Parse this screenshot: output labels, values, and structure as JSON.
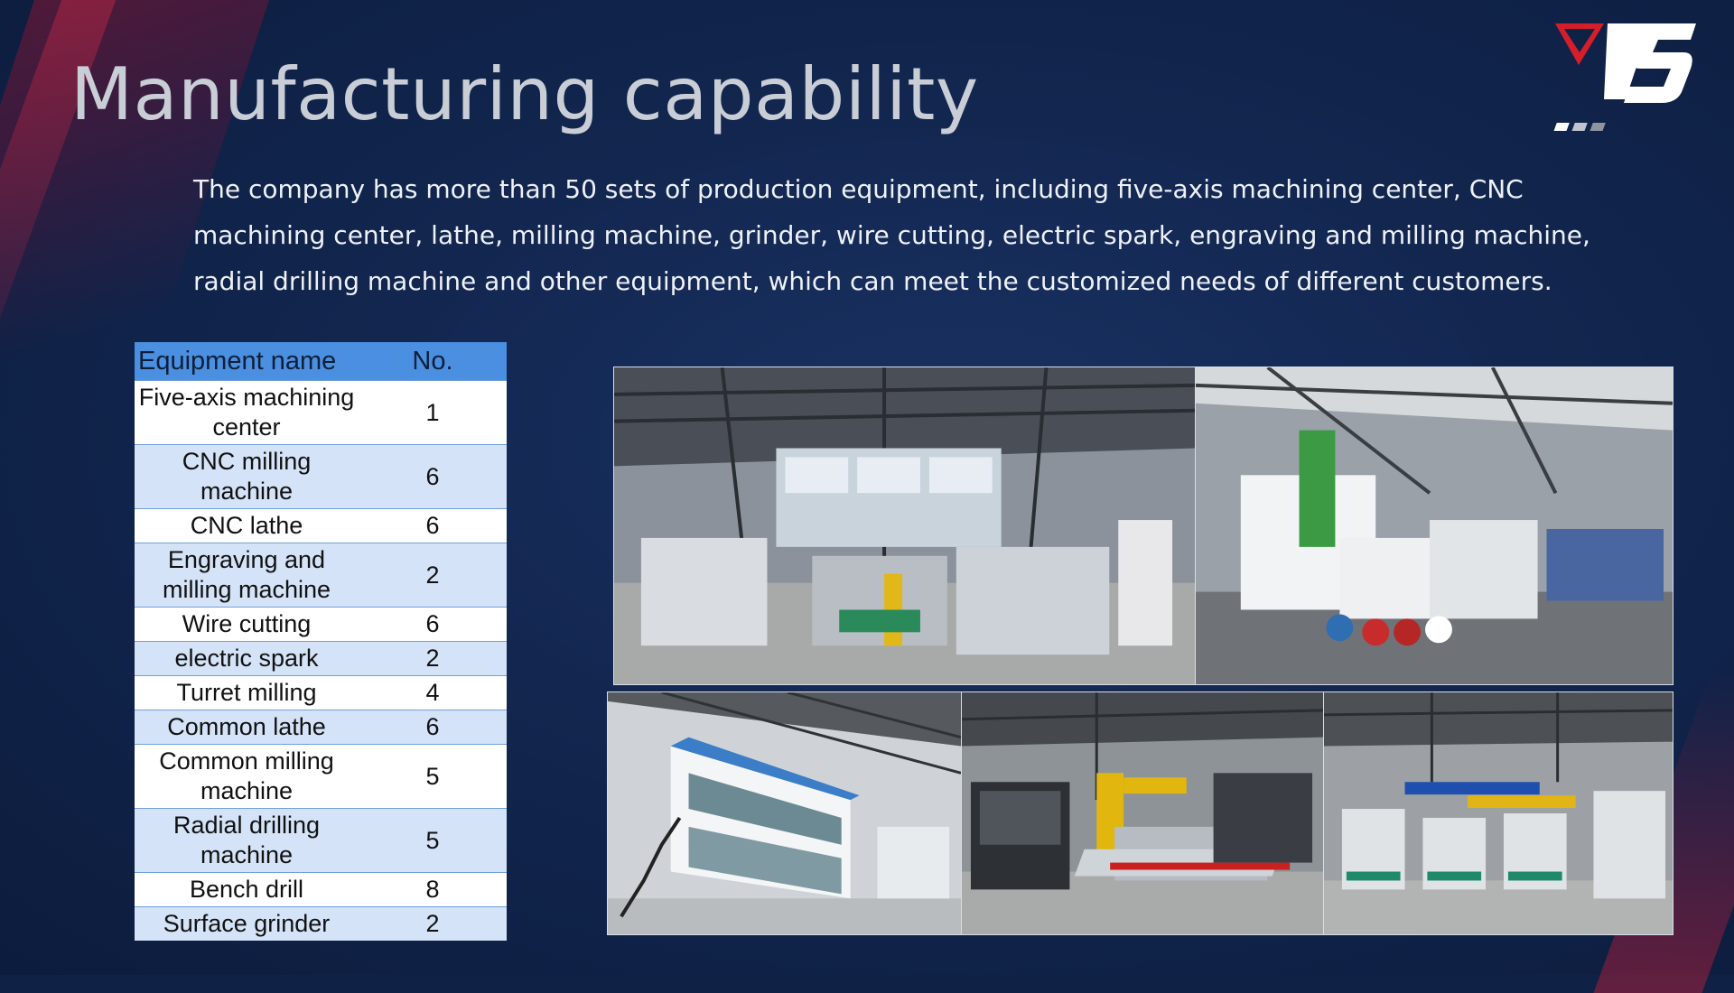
{
  "slide": {
    "title": "Manufacturing capability",
    "intro": "The company has more than 50 sets of production equipment, including five-axis machining center, CNC machining center, lathe, milling machine, grinder, wire cutting, electric spark, engraving and milling machine, radial drilling machine and other equipment, which can meet the customized needs of different customers."
  },
  "table": {
    "headers": [
      "Equipment name",
      "No."
    ],
    "rows": [
      {
        "name": "Five-axis machining center",
        "no": "1"
      },
      {
        "name": "CNC milling machine",
        "no": "6"
      },
      {
        "name": "CNC lathe",
        "no": "6"
      },
      {
        "name": "Engraving and milling machine",
        "no": "2"
      },
      {
        "name": "Wire cutting",
        "no": "6"
      },
      {
        "name": "electric spark",
        "no": "2"
      },
      {
        "name": "Turret milling",
        "no": "4"
      },
      {
        "name": "Common lathe",
        "no": "6"
      },
      {
        "name": "Common milling machine",
        "no": "5"
      },
      {
        "name": "Radial drilling machine",
        "no": "5"
      },
      {
        "name": "Bench drill",
        "no": "8"
      },
      {
        "name": "Surface grinder",
        "no": "2"
      }
    ]
  },
  "photos": [
    {
      "icon": "factory-floor-photo"
    },
    {
      "icon": "machining-center-photo"
    },
    {
      "icon": "office-building-photo"
    },
    {
      "icon": "robot-cell-photo"
    },
    {
      "icon": "assembly-line-photo"
    }
  ],
  "colors": {
    "background": "#0f2145",
    "table_header": "#4a8fe0",
    "row_alt": "#d4e3f7",
    "logo_red": "#d41f2a"
  }
}
